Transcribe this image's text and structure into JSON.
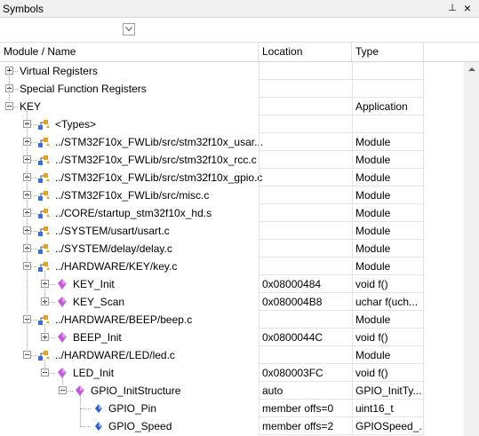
{
  "window": {
    "title": "Symbols",
    "pin_glyph": "⊥",
    "close_glyph": "×"
  },
  "columns": {
    "name": "Module / Name",
    "location": "Location",
    "type": "Type"
  },
  "rows": [
    {
      "name": "Virtual Registers",
      "location": "",
      "type": "",
      "depth": 0,
      "expander": "plus",
      "icon": "none"
    },
    {
      "name": "Special Function Registers",
      "location": "",
      "type": "",
      "depth": 0,
      "expander": "plus",
      "icon": "none"
    },
    {
      "name": "KEY",
      "location": "",
      "type": "Application",
      "depth": 0,
      "expander": "minus",
      "icon": "none"
    },
    {
      "name": "<Types>",
      "location": "",
      "type": "",
      "depth": 1,
      "expander": "plus",
      "icon": "module-icon"
    },
    {
      "name": "../STM32F10x_FWLib/src/stm32f10x_usar...",
      "location": "",
      "type": "Module",
      "depth": 1,
      "expander": "plus",
      "icon": "module-icon"
    },
    {
      "name": "../STM32F10x_FWLib/src/stm32f10x_rcc.c",
      "location": "",
      "type": "Module",
      "depth": 1,
      "expander": "plus",
      "icon": "module-icon"
    },
    {
      "name": "../STM32F10x_FWLib/src/stm32f10x_gpio.c",
      "location": "",
      "type": "Module",
      "depth": 1,
      "expander": "plus",
      "icon": "module-icon"
    },
    {
      "name": "../STM32F10x_FWLib/src/misc.c",
      "location": "",
      "type": "Module",
      "depth": 1,
      "expander": "plus",
      "icon": "module-icon"
    },
    {
      "name": "../CORE/startup_stm32f10x_hd.s",
      "location": "",
      "type": "Module",
      "depth": 1,
      "expander": "plus",
      "icon": "module-icon"
    },
    {
      "name": "../SYSTEM/usart/usart.c",
      "location": "",
      "type": "Module",
      "depth": 1,
      "expander": "plus",
      "icon": "module-icon"
    },
    {
      "name": "../SYSTEM/delay/delay.c",
      "location": "",
      "type": "Module",
      "depth": 1,
      "expander": "plus",
      "icon": "module-icon"
    },
    {
      "name": "../HARDWARE/KEY/key.c",
      "location": "",
      "type": "Module",
      "depth": 1,
      "expander": "minus",
      "icon": "module-icon"
    },
    {
      "name": "KEY_Init",
      "location": "0x08000484",
      "type": "void f()",
      "depth": 2,
      "expander": "plus",
      "icon": "function-icon"
    },
    {
      "name": "KEY_Scan",
      "location": "0x080004B8",
      "type": "uchar f(uch...",
      "depth": 2,
      "expander": "plus",
      "icon": "function-icon"
    },
    {
      "name": "../HARDWARE/BEEP/beep.c",
      "location": "",
      "type": "Module",
      "depth": 1,
      "expander": "minus",
      "icon": "module-icon"
    },
    {
      "name": "BEEP_Init",
      "location": "0x0800044C",
      "type": "void f()",
      "depth": 2,
      "expander": "plus",
      "icon": "function-icon"
    },
    {
      "name": "../HARDWARE/LED/led.c",
      "location": "",
      "type": "Module",
      "depth": 1,
      "expander": "minus",
      "icon": "module-icon"
    },
    {
      "name": "LED_Init",
      "location": "0x080003FC",
      "type": "void f()",
      "depth": 2,
      "expander": "minus",
      "icon": "function-icon"
    },
    {
      "name": "GPIO_InitStructure",
      "location": "auto",
      "type": "GPIO_InitTy...",
      "depth": 3,
      "expander": "minus",
      "icon": "variable-icon"
    },
    {
      "name": "GPIO_Pin",
      "location": "member offs=0",
      "type": "uint16_t",
      "depth": 4,
      "expander": "none",
      "icon": "member-icon"
    },
    {
      "name": "GPIO_Speed",
      "location": "member offs=2",
      "type": "GPIOSpeed_...",
      "depth": 4,
      "expander": "none",
      "icon": "member-icon"
    }
  ],
  "colors": {
    "module_icon_blue": "#3a6fd8",
    "module_icon_orange": "#e8a020",
    "function_icon": "#c25bd6",
    "member_icon": "#2a5fc8"
  }
}
